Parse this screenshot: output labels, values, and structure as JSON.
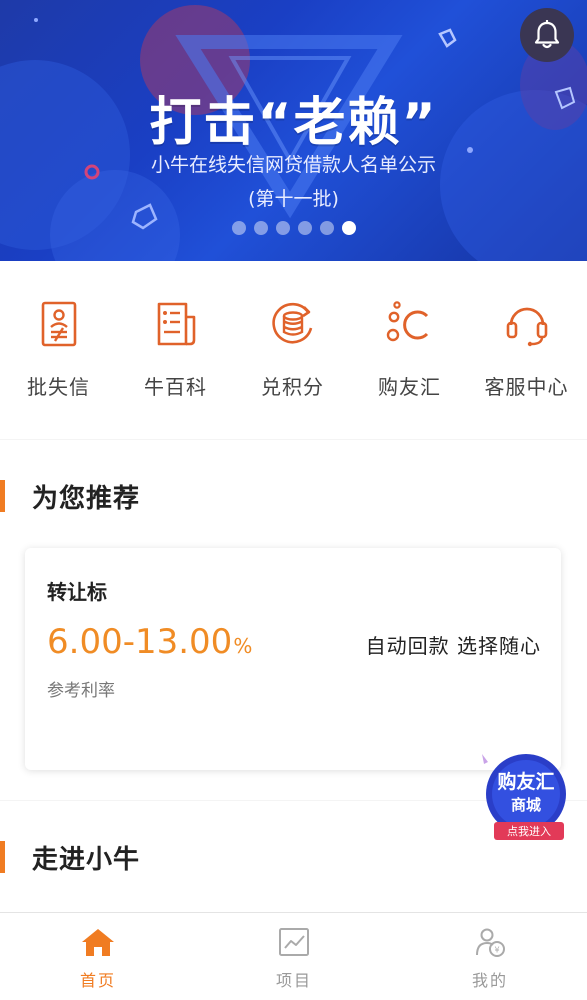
{
  "banner": {
    "title": "打击“老赖”",
    "subtitle": "小牛在线失信网贷借款人名单公示",
    "batch": "(第十一批)",
    "slides": 6,
    "active_slide": 6
  },
  "quick_menu": [
    {
      "label": "批失信",
      "icon": "id-card-icon"
    },
    {
      "label": "牛百科",
      "icon": "document-icon"
    },
    {
      "label": "兑积分",
      "icon": "coin-exchange-icon"
    },
    {
      "label": "购友汇",
      "icon": "bubbles-c-icon"
    },
    {
      "label": "客服中心",
      "icon": "headset-icon"
    }
  ],
  "recommend": {
    "section_title": "为您推荐",
    "card": {
      "name": "转让标",
      "rate": "6.00-13.00",
      "rate_unit": "%",
      "rate_label": "参考利率",
      "desc": "自动回款  选择随心"
    }
  },
  "about": {
    "section_title": "走进小牛"
  },
  "float_badge": {
    "title": "购友汇",
    "subtitle": "商城",
    "cta": "点我进入"
  },
  "tabbar": [
    {
      "label": "首页",
      "icon": "home-icon",
      "active": true
    },
    {
      "label": "项目",
      "icon": "chart-icon",
      "active": false
    },
    {
      "label": "我的",
      "icon": "user-icon",
      "active": false
    }
  ],
  "colors": {
    "accent": "#f07c22",
    "rate": "#f08c25",
    "banner_blue": "#1a3fc4",
    "icon_orange": "#e0622a"
  }
}
